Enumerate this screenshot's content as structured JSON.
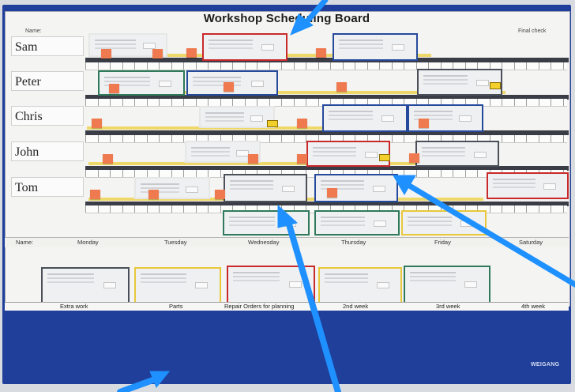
{
  "board": {
    "title": "Workshop Scheduling Board",
    "name_header": "Name:",
    "final_check": "Final check",
    "brand": "WEIGANG"
  },
  "rows": [
    {
      "name": "Sam"
    },
    {
      "name": "Peter"
    },
    {
      "name": "Chris"
    },
    {
      "name": "John"
    },
    {
      "name": "Tom"
    }
  ],
  "days_header": {
    "name": "Name:",
    "days": [
      "Monday",
      "Tuesday",
      "Wednesday",
      "Thursday",
      "Friday",
      "Saturday"
    ]
  },
  "bottom_labels": [
    "Extra work",
    "Parts",
    "Repair Orders for planning",
    "2nd week",
    "3rd week",
    "4th week"
  ],
  "colors": {
    "board_blue": "#1f3f9a",
    "arrow_blue": "#1e90ff",
    "sleeve_red": "#c9292b",
    "sleeve_blue": "#254a9c",
    "sleeve_green": "#2f7a5a",
    "sleeve_yellow": "#e8c83a",
    "sticky_orange": "#f07a4f"
  }
}
